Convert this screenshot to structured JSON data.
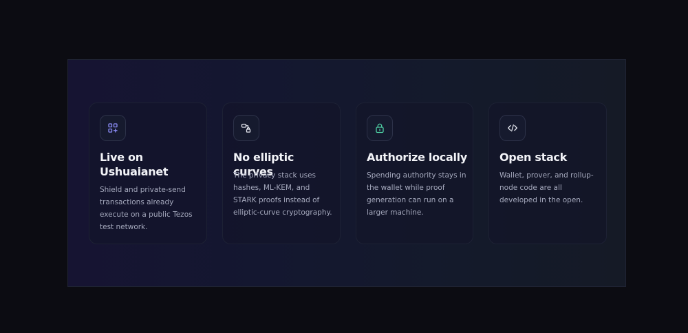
{
  "features": [
    {
      "icon": "apps-add-icon",
      "title": "Live on Ushuaianet",
      "description": "Shield and private-send transactions already execute on a public Tezos test network."
    },
    {
      "icon": "link-lock-icon",
      "title": "No elliptic curves",
      "description": "The privacy stack uses hashes, ML-KEM, and STARK proofs instead of elliptic-curve cryptography."
    },
    {
      "icon": "lock-icon",
      "title": "Authorize locally",
      "description": "Spending authority stays in the wallet while proof generation can run on a larger machine."
    },
    {
      "icon": "code-icon",
      "title": "Open stack",
      "description": "Wallet, prover, and rollup-node code are all developed in the open."
    }
  ],
  "colors": {
    "icon_violet": "#8b8cf6",
    "icon_green": "#4fd1a5",
    "icon_white": "#e6e8f0"
  }
}
